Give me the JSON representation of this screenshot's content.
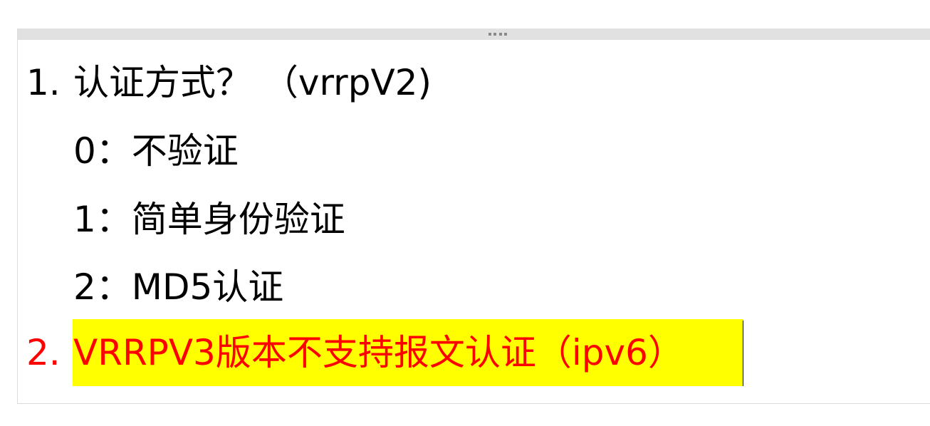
{
  "slide": {
    "item1": {
      "number": "1.",
      "text": "认证方式？ （vrrpV2)"
    },
    "options": [
      {
        "text": "0：不验证"
      },
      {
        "text": "1：简单身份验证"
      },
      {
        "text": "2：MD5认证"
      }
    ],
    "item2": {
      "number": "2.",
      "text": "VRRPV3版本不支持报文认证（ipv6）",
      "color": "#ff0000",
      "highlight_color": "#ffff00"
    }
  }
}
